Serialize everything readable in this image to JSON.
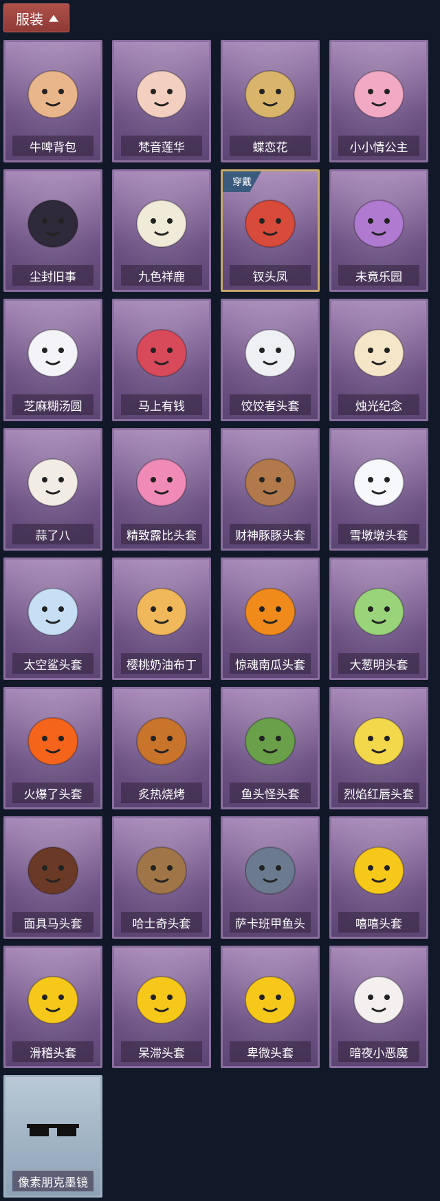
{
  "header": {
    "tab_label": "服装"
  },
  "items": [
    {
      "label": "牛啤背包",
      "icon": "cow-beer-backpack-icon",
      "color": "#e9b58a"
    },
    {
      "label": "梵音莲华",
      "icon": "lotus-fairy-pendant-icon",
      "color": "#f3cfc0"
    },
    {
      "label": "蝶恋花",
      "icon": "butterfly-bell-pendant-icon",
      "color": "#d8b56a"
    },
    {
      "label": "小小情公主",
      "icon": "little-princess-icon",
      "color": "#f1a9c4"
    },
    {
      "label": "尘封旧事",
      "icon": "dark-figure-pendant-icon",
      "color": "#2f2a3a"
    },
    {
      "label": "九色祥鹿",
      "icon": "deer-pendant-icon",
      "color": "#f0ead8"
    },
    {
      "label": "钗头凤",
      "icon": "phoenix-crown-doll-icon",
      "color": "#d84a3a",
      "badge": "穿戴",
      "selected": true
    },
    {
      "label": "未竟乐园",
      "icon": "purple-hair-doll-icon",
      "color": "#b07ad0"
    },
    {
      "label": "芝麻糊汤圆",
      "icon": "rice-ball-head-icon",
      "color": "#f4f4f8"
    },
    {
      "label": "马上有钱",
      "icon": "red-horse-head-icon",
      "color": "#d84a5a"
    },
    {
      "label": "饺饺者头套",
      "icon": "dumpling-head-icon",
      "color": "#eef0f4"
    },
    {
      "label": "烛光纪念",
      "icon": "candle-head-icon",
      "color": "#f5e6c8"
    },
    {
      "label": "蒜了八",
      "icon": "garlic-head-icon",
      "color": "#f2ede4"
    },
    {
      "label": "精致露比头套",
      "icon": "pink-beaver-head-icon",
      "color": "#f08ab6"
    },
    {
      "label": "财神豚豚头套",
      "icon": "capybara-head-icon",
      "color": "#b27a4a"
    },
    {
      "label": "雪墩墩头套",
      "icon": "snowman-head-icon",
      "color": "#f6f8fc"
    },
    {
      "label": "太空鲨头套",
      "icon": "shark-head-icon",
      "color": "#c6dff4"
    },
    {
      "label": "樱桃奶油布丁",
      "icon": "pudding-head-icon",
      "color": "#f0b85a"
    },
    {
      "label": "惊魂南瓜头套",
      "icon": "pumpkin-head-icon",
      "color": "#f08a1a"
    },
    {
      "label": "大葱明头套",
      "icon": "scallion-head-icon",
      "color": "#9ad47a"
    },
    {
      "label": "火爆了头套",
      "icon": "fire-head-icon",
      "color": "#f4641a"
    },
    {
      "label": "炙热烧烤",
      "icon": "bbq-meat-head-icon",
      "color": "#c8742a"
    },
    {
      "label": "鱼头怪头套",
      "icon": "fish-head-icon",
      "color": "#6aa04a"
    },
    {
      "label": "烈焰红唇头套",
      "icon": "yellow-pikachu-head-icon",
      "color": "#f2d84a"
    },
    {
      "label": "面具马头套",
      "icon": "horse-mask-icon",
      "color": "#6a3a26"
    },
    {
      "label": "哈士奇头套",
      "icon": "husky-head-icon",
      "color": "#a07648"
    },
    {
      "label": "萨卡班甲鱼头",
      "icon": "sacabambaspis-head-icon",
      "color": "#6b7a8e"
    },
    {
      "label": "嘻嘻头套",
      "icon": "grin-emoji-head-icon",
      "color": "#f6c81a"
    },
    {
      "label": "滑稽头套",
      "icon": "funny-emoji-head-icon",
      "color": "#f6c81a"
    },
    {
      "label": "呆滞头套",
      "icon": "dazed-emoji-head-icon",
      "color": "#f6c81a"
    },
    {
      "label": "卑微头套",
      "icon": "humble-emoji-head-icon",
      "color": "#f6c81a"
    },
    {
      "label": "暗夜小恶魔",
      "icon": "devil-mask-icon",
      "color": "#f4f0f0"
    },
    {
      "label": "像素朋克墨镜",
      "icon": "pixel-sunglasses-icon",
      "color": "#111111",
      "special": true
    }
  ]
}
